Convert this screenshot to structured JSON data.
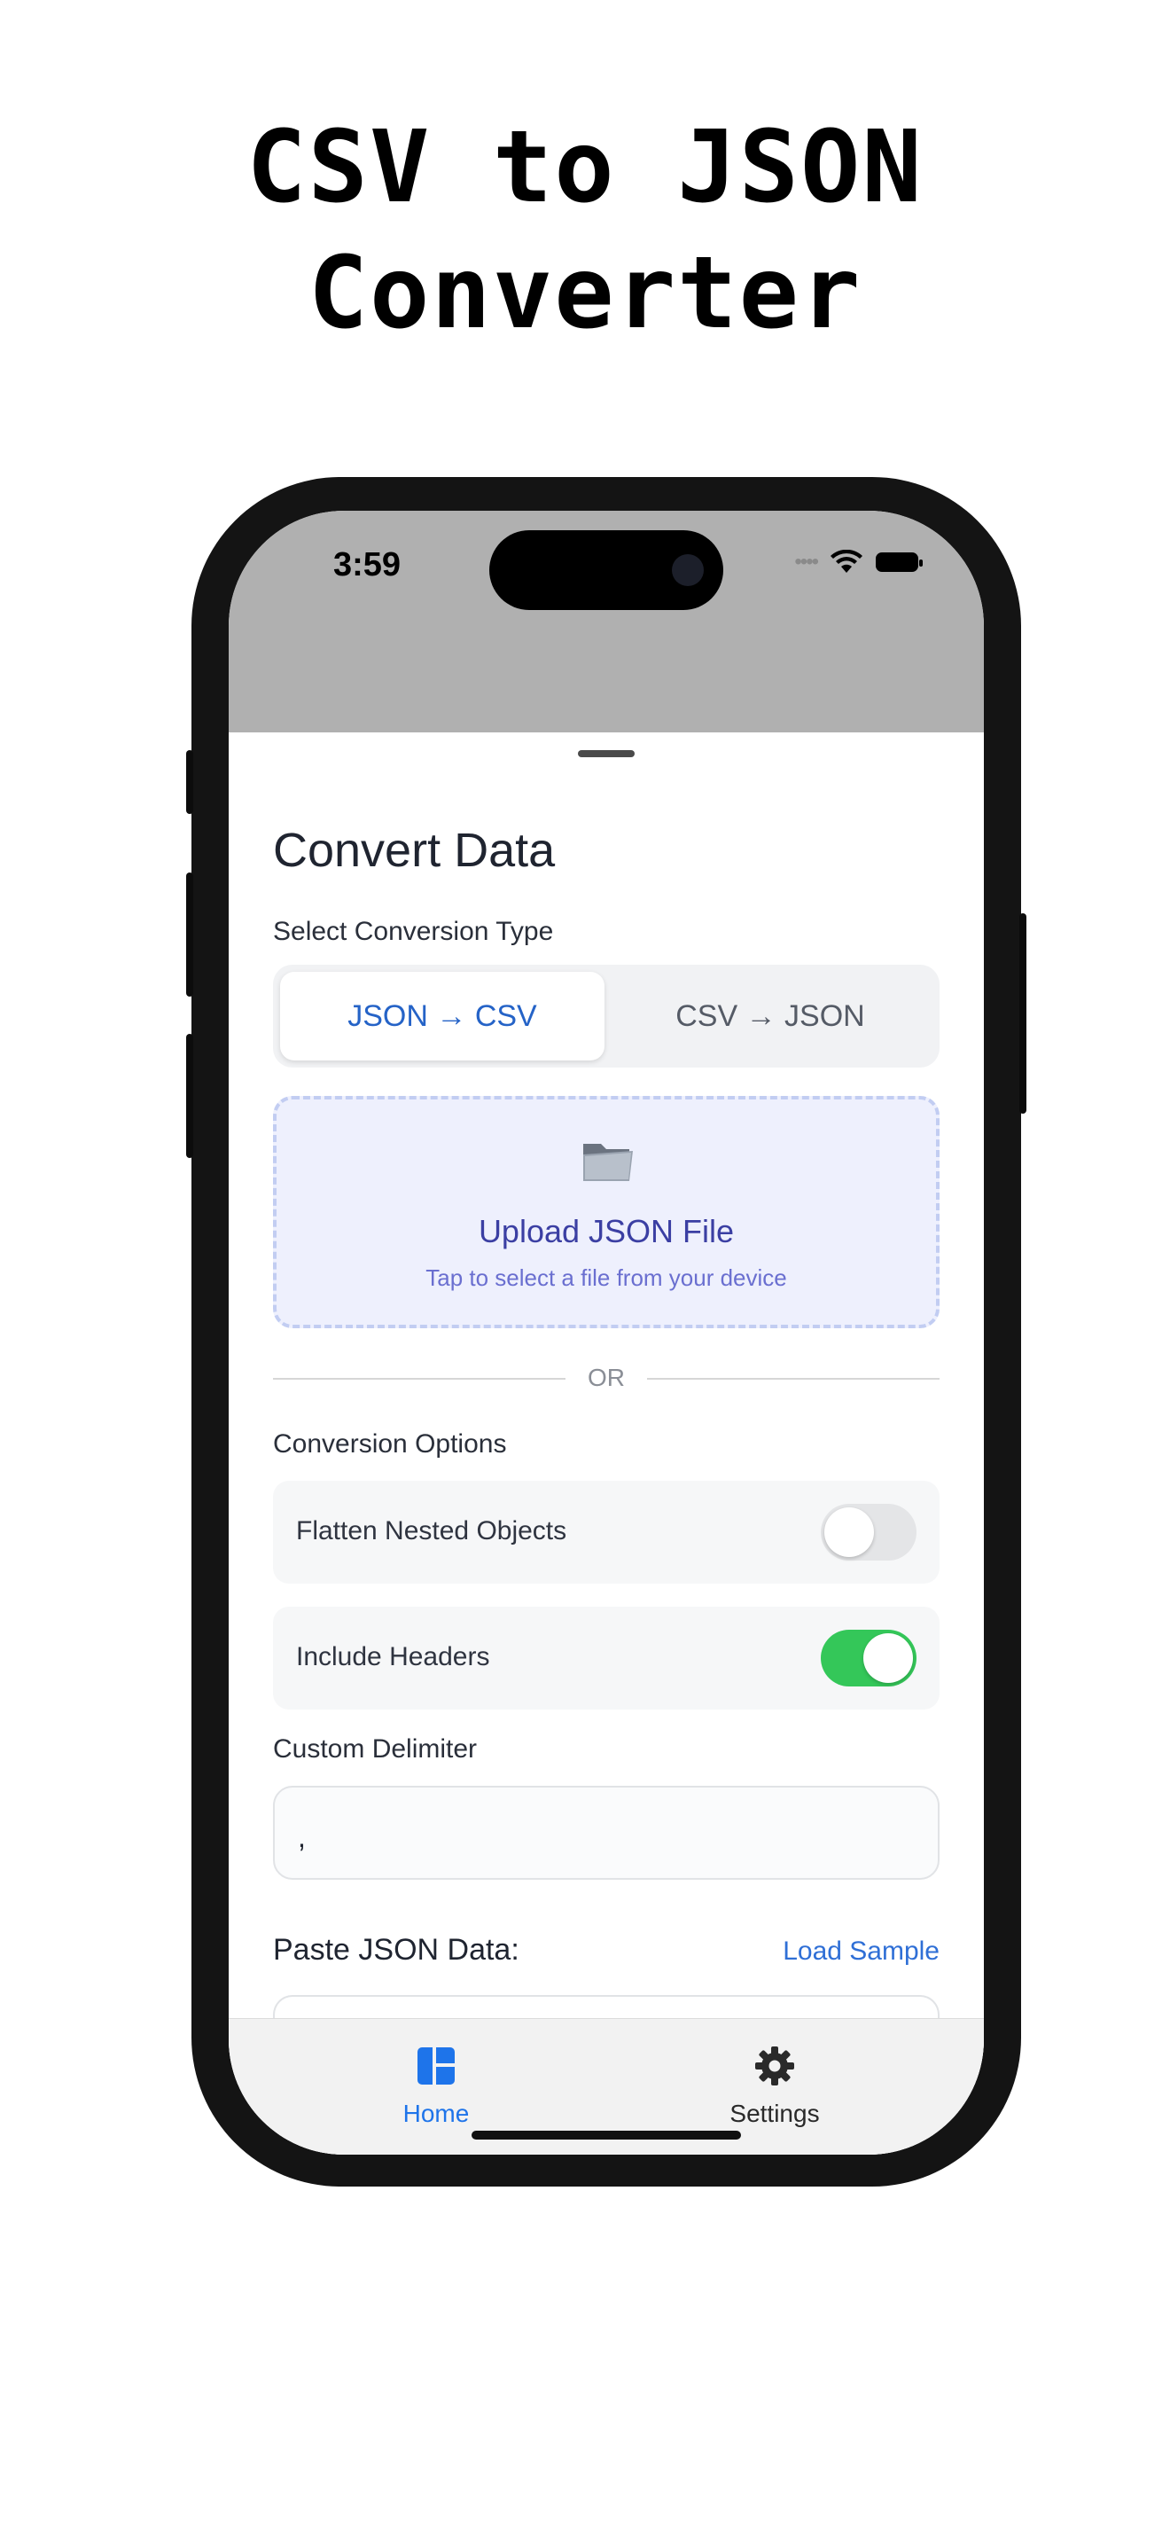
{
  "promo": {
    "title_line1": "CSV to JSON",
    "title_line2": "Converter"
  },
  "status_bar": {
    "time": "3:59"
  },
  "sheet": {
    "title": "Convert Data",
    "conversion_type_label": "Select Conversion Type",
    "segments": [
      {
        "label": "JSON → CSV",
        "selected": true
      },
      {
        "label": "CSV → JSON",
        "selected": false
      }
    ],
    "upload": {
      "icon": "folder-icon",
      "title": "Upload JSON File",
      "subtitle": "Tap to select a file from your device"
    },
    "or_text": "OR",
    "options_label": "Conversion Options",
    "options": [
      {
        "label": "Flatten Nested Objects",
        "enabled": false
      },
      {
        "label": "Include Headers",
        "enabled": true
      }
    ],
    "delimiter_label": "Custom Delimiter",
    "delimiter_value": ",",
    "paste_label": "Paste JSON Data:",
    "load_sample": "Load Sample"
  },
  "tabbar": {
    "items": [
      {
        "label": "Home",
        "icon": "dashboard-icon",
        "active": true
      },
      {
        "label": "Settings",
        "icon": "gear-icon",
        "active": false
      }
    ]
  },
  "colors": {
    "accent": "#2563c7",
    "toggle_on": "#34c759",
    "upload_bg": "#eef0fd",
    "tab_active": "#1e74ea"
  }
}
